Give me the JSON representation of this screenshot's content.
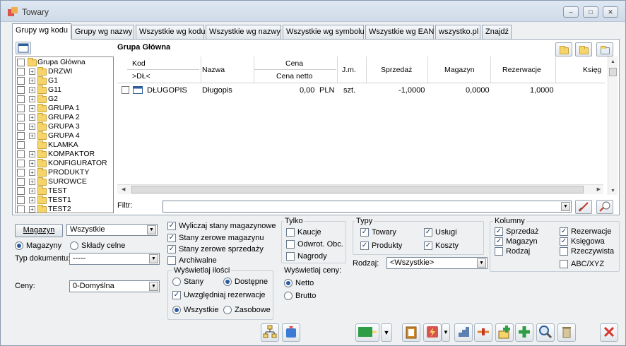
{
  "window": {
    "title": "Towary",
    "min": "–",
    "max": "□",
    "close": "✕"
  },
  "tabs": [
    "Grupy wg kodu",
    "Grupy wg nazwy",
    "Wszystkie wg kodu",
    "Wszystkie wg nazwy",
    "Wszystkie wg symbolu",
    "Wszystkie wg EAN",
    "wszystko.pl",
    "Znajdź"
  ],
  "group_title": "Grupa Główna",
  "tree": [
    "Grupa Główna",
    "DRZWI",
    "G1",
    "G11",
    "G2",
    "GRUPA 1",
    "GRUPA 2",
    "GRUPA 3",
    "GRUPA 4",
    "KLAMKA",
    "KOMPAKTOR",
    "KONFIGURATOR",
    "PRODUKTY",
    "SUROWCE",
    "TEST",
    "TEST1",
    "TEST2"
  ],
  "columns": {
    "kod": "Kod",
    "kod_sub": ">DŁ<",
    "nazwa": "Nazwa",
    "cena": "Cena",
    "cena_sub": "Cena netto",
    "jm": "J.m.",
    "sprzedaz": "Sprzedaż",
    "magazyn": "Magazyn",
    "rezerwacje": "Rezerwacje",
    "ksiegowa": "Księg"
  },
  "row": {
    "kod": "DŁUGOPIS",
    "nazwa": "Długopis",
    "cena": "0,00",
    "waluta": "PLN",
    "jm": "szt.",
    "sprzedaz": "-1,0000",
    "magazyn": "0,0000",
    "rezerwacje": "1,0000"
  },
  "filter": {
    "label": "Filtr:",
    "value": ""
  },
  "left": {
    "magazyn_btn": "Magazyn",
    "magazyn_val": "Wszystkie",
    "radio1": "Magazyny",
    "radio2": "Składy celne",
    "typ_label": "Typ dokumentu:",
    "typ_val": "-----",
    "ceny_label": "Ceny:",
    "ceny_val": "0-Domyślna"
  },
  "opts": {
    "o1": "Wyliczaj stany magazynowe",
    "o2": "Stany zerowe magazynu",
    "o3": "Stany zerowe sprzedaży",
    "o4": "Archiwalne"
  },
  "ilosci": {
    "title": "Wyświetlaj ilości",
    "stany": "Stany",
    "dostepne": "Dostępne",
    "uwzgl": "Uwzględniaj rezerwacje",
    "wszystkie": "Wszystkie",
    "zasobowe": "Zasobowe"
  },
  "tylko": {
    "title": "Tylko",
    "kaucje": "Kaucje",
    "odwrot": "Odwrot. Obc.",
    "nagrody": "Nagrody"
  },
  "ceny_disp": {
    "title": "Wyświetlaj ceny:",
    "netto": "Netto",
    "brutto": "Brutto"
  },
  "typy": {
    "title": "Typy",
    "towary": "Towary",
    "uslugi": "Usługi",
    "produkty": "Produkty",
    "koszty": "Koszty",
    "rodzaj_label": "Rodzaj:",
    "rodzaj_val": "<Wszystkie>"
  },
  "kolumny": {
    "title": "Kolumny",
    "sprzedaz": "Sprzedaż",
    "rezerwacje": "Rezerwacje",
    "magazyn": "Magazyn",
    "ksiegowa": "Księgowa",
    "rodzaj": "Rodzaj",
    "rzeczywista": "Rzeczywista",
    "abc": "ABC/XYZ"
  }
}
